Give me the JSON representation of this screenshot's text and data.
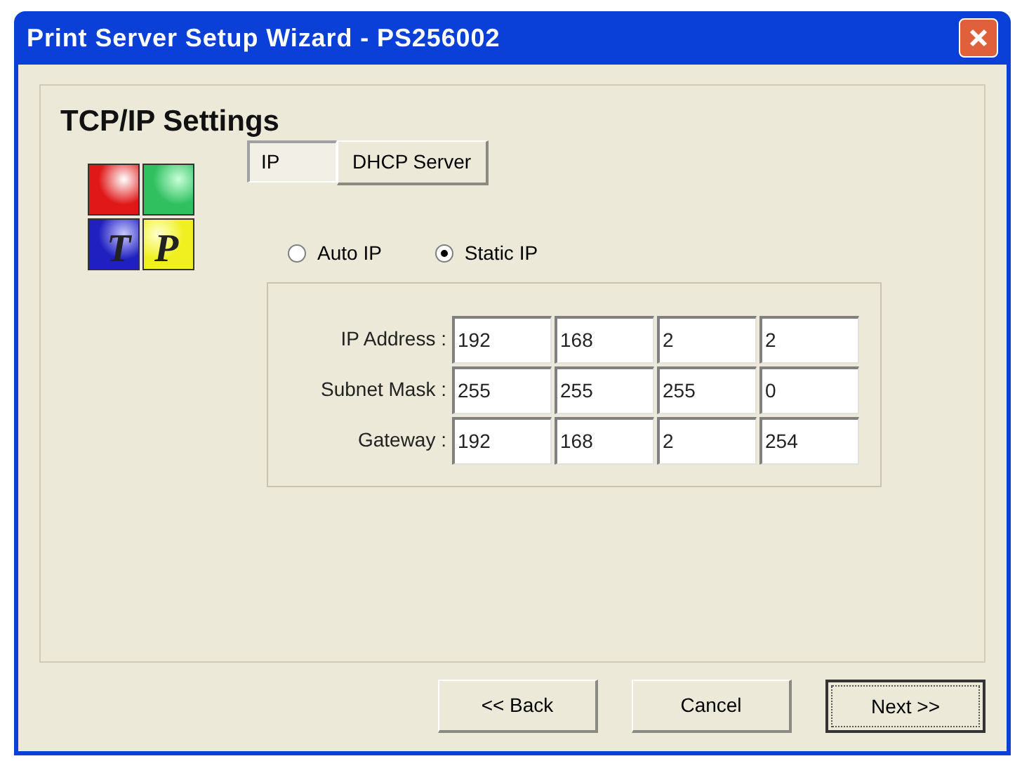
{
  "window": {
    "title": "Print Server Setup Wizard - PS256002"
  },
  "heading": "TCP/IP Settings",
  "logo": {
    "letters": [
      "T",
      "P"
    ]
  },
  "tabs": [
    {
      "label": "IP",
      "selected": true
    },
    {
      "label": "DHCP Server",
      "selected": false
    }
  ],
  "radios": [
    {
      "label": "Auto IP",
      "selected": false
    },
    {
      "label": "Static IP",
      "selected": true
    }
  ],
  "fields": [
    {
      "label": "IP Address :",
      "octets": [
        "192",
        "168",
        "2",
        "2"
      ]
    },
    {
      "label": "Subnet Mask :",
      "octets": [
        "255",
        "255",
        "255",
        "0"
      ]
    },
    {
      "label": "Gateway :",
      "octets": [
        "192",
        "168",
        "2",
        "254"
      ]
    }
  ],
  "buttons": [
    {
      "label": "<< Back",
      "default": false
    },
    {
      "label": "Cancel",
      "default": false
    },
    {
      "label": "Next >>",
      "default": true
    }
  ]
}
